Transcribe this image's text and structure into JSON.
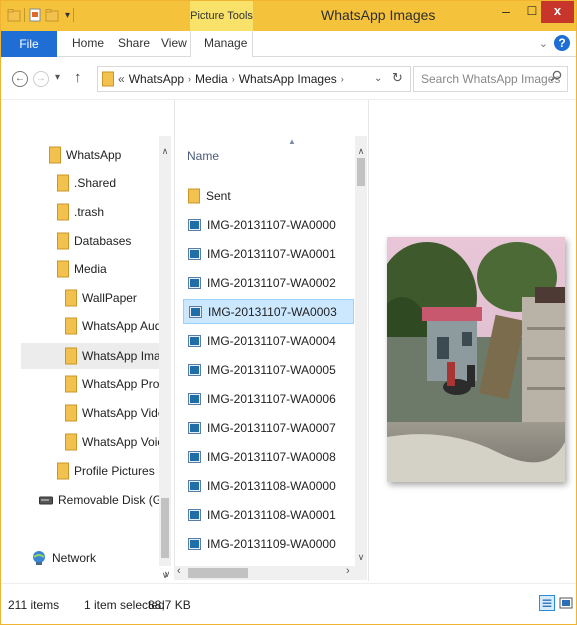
{
  "window": {
    "title": "WhatsApp Images",
    "context_tab": "Picture Tools"
  },
  "titlebar": {
    "minimize": "–",
    "maximize": "☐",
    "close": "x",
    "qat_arrow": "▾"
  },
  "ribbon": {
    "tabs": [
      "File",
      "Home",
      "Share",
      "View",
      "Manage"
    ],
    "expand": "⌄",
    "help": "?"
  },
  "address": {
    "back": "←",
    "forward": "→",
    "recent": "▾",
    "up": "↑",
    "overflow": "«",
    "breadcrumb": [
      "WhatsApp",
      "Media",
      "WhatsApp Images"
    ],
    "separator": "›",
    "dropdown": "⌄",
    "refresh": "↻"
  },
  "search": {
    "placeholder": "Search WhatsApp Images"
  },
  "nav": {
    "items": [
      {
        "label": "WhatsApp",
        "icon": "folder-icon"
      },
      {
        "label": ".Shared",
        "icon": "folder-icon"
      },
      {
        "label": ".trash",
        "icon": "folder-icon"
      },
      {
        "label": "Databases",
        "icon": "folder-icon"
      },
      {
        "label": "Media",
        "icon": "folder-icon"
      },
      {
        "label": "WallPaper",
        "icon": "folder-icon"
      },
      {
        "label": "WhatsApp Audio",
        "icon": "folder-icon"
      },
      {
        "label": "WhatsApp Images",
        "icon": "folder-icon",
        "selected": true
      },
      {
        "label": "WhatsApp Profile Pi",
        "icon": "folder-icon"
      },
      {
        "label": "WhatsApp Video",
        "icon": "folder-icon"
      },
      {
        "label": "WhatsApp Voice Nc",
        "icon": "folder-icon"
      },
      {
        "label": "Profile Pictures",
        "icon": "folder-icon"
      },
      {
        "label": "Removable Disk (G:)",
        "icon": "drive-icon"
      },
      {
        "label": "Network",
        "icon": "network-icon"
      }
    ],
    "scroll_up": "∧",
    "scroll_down": "∨"
  },
  "list": {
    "column": "Name",
    "sort_indicator": "▲",
    "items": [
      {
        "name": "Sent",
        "type": "folder"
      },
      {
        "name": "IMG-20131107-WA0000",
        "type": "image"
      },
      {
        "name": "IMG-20131107-WA0001",
        "type": "image"
      },
      {
        "name": "IMG-20131107-WA0002",
        "type": "image"
      },
      {
        "name": "IMG-20131107-WA0003",
        "type": "image",
        "selected": true
      },
      {
        "name": "IMG-20131107-WA0004",
        "type": "image"
      },
      {
        "name": "IMG-20131107-WA0005",
        "type": "image"
      },
      {
        "name": "IMG-20131107-WA0006",
        "type": "image"
      },
      {
        "name": "IMG-20131107-WA0007",
        "type": "image"
      },
      {
        "name": "IMG-20131107-WA0008",
        "type": "image"
      },
      {
        "name": "IMG-20131108-WA0000",
        "type": "image"
      },
      {
        "name": "IMG-20131108-WA0001",
        "type": "image"
      },
      {
        "name": "IMG-20131109-WA0000",
        "type": "image"
      }
    ],
    "scroll_up": "∧",
    "scroll_down": "∨",
    "scroll_left": "‹",
    "scroll_right": "›"
  },
  "status": {
    "item_count": "211 items",
    "selection": "1 item selected",
    "size": "88,7 KB"
  },
  "colors": {
    "title_bar": "#f5c23c",
    "context_tab": "#f8e26a",
    "file_tab": "#1e6ed6",
    "close": "#c7352b",
    "selection": "#cce8ff",
    "folder": "#f2c14e"
  }
}
